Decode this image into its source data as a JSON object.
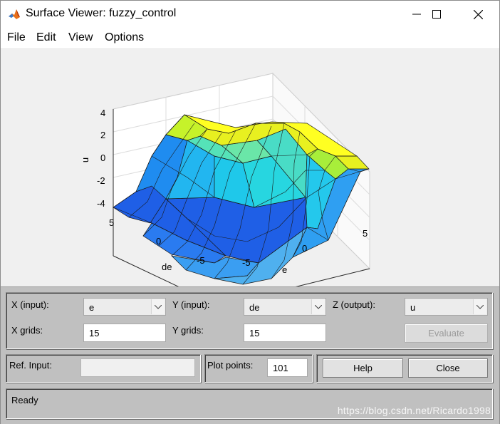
{
  "window": {
    "title": "Surface Viewer: fuzzy_control",
    "icon": "matlab-logo-icon",
    "controls": {
      "minimize": "minimize-icon",
      "maximize": "maximize-icon",
      "close": "close-icon"
    }
  },
  "menu": {
    "items": [
      {
        "label": "File"
      },
      {
        "label": "Edit"
      },
      {
        "label": "View"
      },
      {
        "label": "Options"
      }
    ]
  },
  "plot": {
    "zlabel": "u",
    "xlabel": "e",
    "ylabel": "de",
    "zticks": [
      "4",
      "2",
      "0",
      "-2",
      "-4"
    ],
    "xticks": [
      "-5",
      "0",
      "5"
    ],
    "yticks": [
      "5",
      "0",
      "-5"
    ],
    "colors": {
      "low": "#1f5fe6",
      "mid": "#1fd2e6",
      "high": "#ffff22"
    }
  },
  "controls": {
    "x_input_label": "X (input):",
    "x_input_value": "e",
    "y_input_label": "Y (input):",
    "y_input_value": "de",
    "z_output_label": "Z (output):",
    "z_output_value": "u",
    "x_grids_label": "X grids:",
    "x_grids_value": "15",
    "y_grids_label": "Y grids:",
    "y_grids_value": "15",
    "evaluate_label": "Evaluate",
    "ref_input_label": "Ref. Input:",
    "ref_input_value": "",
    "plot_points_label": "Plot points:",
    "plot_points_value": "101",
    "help_label": "Help",
    "close_label": "Close"
  },
  "status": {
    "text": "Ready"
  },
  "watermark": "https://blog.csdn.net/Ricardo1998"
}
